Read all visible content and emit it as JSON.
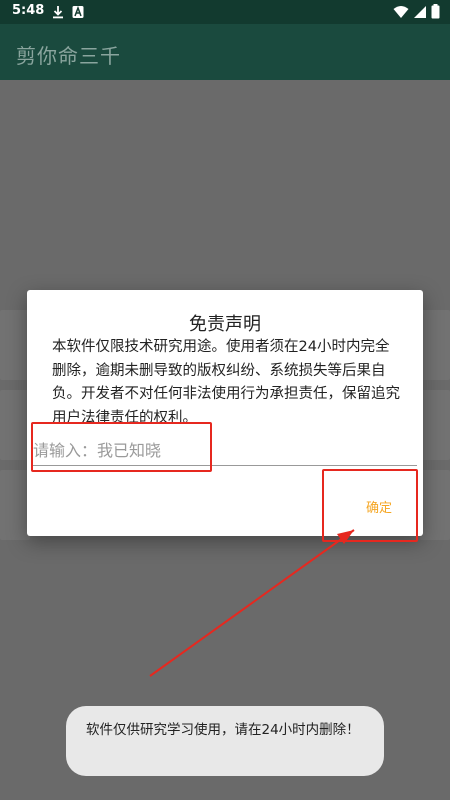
{
  "status_bar": {
    "time": "5:48",
    "icons": [
      "download-icon",
      "notification-a-icon",
      "wifi-icon",
      "signal-icon",
      "battery-icon"
    ]
  },
  "app_bar": {
    "title": "剪你命三千"
  },
  "dialog": {
    "title": "免责声明",
    "message": "本软件仅限技术研究用途。使用者须在24小时内完全删除，逾期未删导致的版权纠纷、系统损失等后果自负。开发者不对任何非法使用行为承担责任，保留追究用户法律责任的权利。",
    "input_placeholder": "请输入：我已知晓",
    "input_value": "",
    "ok_label": "确定"
  },
  "toast": {
    "message": "软件仅供研究学习使用，请在24小时内删除！"
  },
  "colors": {
    "status_bar": "#123a2f",
    "app_bar": "#1a4a3e",
    "scrim": "#6a6a6a",
    "accent": "#f5a623",
    "annotation": "#e6281f"
  }
}
